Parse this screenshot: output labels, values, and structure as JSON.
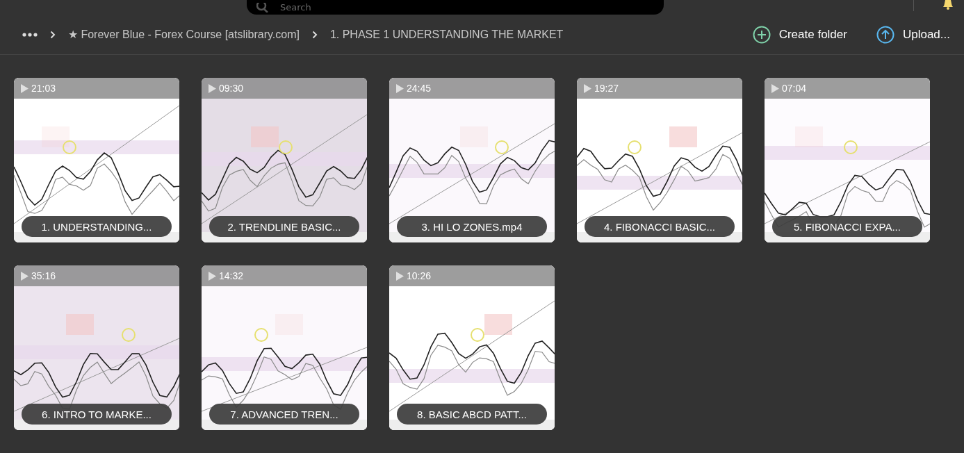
{
  "search": {
    "placeholder": "Search"
  },
  "breadcrumbs": [
    {
      "label": "★ Forever Blue - Forex Course [atslibrary.com]"
    },
    {
      "label": "1. PHASE 1 UNDERSTANDING THE MARKET"
    }
  ],
  "actions": [
    {
      "kind": "create",
      "label": "Create folder"
    },
    {
      "kind": "upload",
      "label": "Upload..."
    }
  ],
  "videos": [
    {
      "duration": "21:03",
      "title": "1. UNDERSTANDING...",
      "kind": "picture"
    },
    {
      "duration": "09:30",
      "title": "2. TRENDLINE BASIC...",
      "kind": "picture"
    },
    {
      "duration": "24:45",
      "title": "3. HI LO ZONES.mp4",
      "kind": "picture"
    },
    {
      "duration": "19:27",
      "title": "4. FIBONACCI BASIC...",
      "kind": "picture"
    },
    {
      "duration": "07:04",
      "title": "5. FIBONACCI EXPA...",
      "kind": "picture"
    },
    {
      "duration": "35:16",
      "title": "6. INTRO TO MARKE...",
      "kind": "picture"
    },
    {
      "duration": "14:32",
      "title": "7. ADVANCED TREN...",
      "kind": "picture"
    },
    {
      "duration": "10:26",
      "title": "8. BASIC ABCD PATT...",
      "kind": "picture"
    }
  ]
}
